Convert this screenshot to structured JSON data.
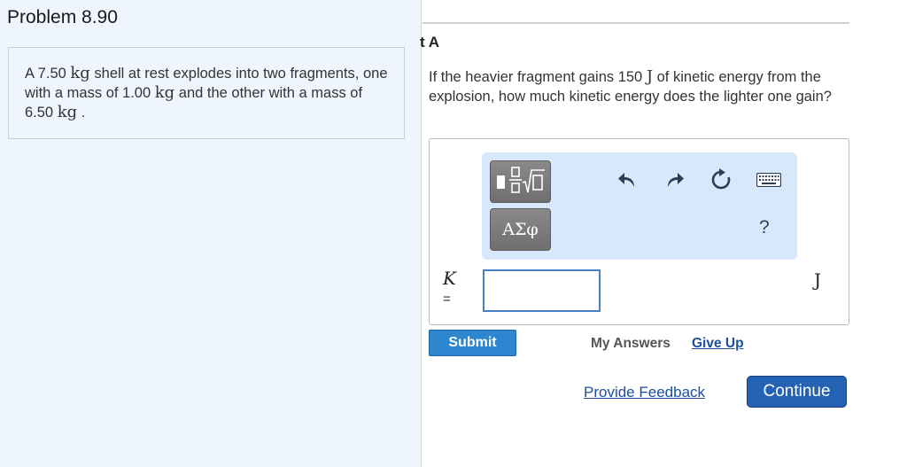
{
  "problem": {
    "title": "Problem 8.90",
    "text": {
      "p1": "A 7.50 ",
      "u1": "kg",
      "p2": " shell at rest explodes into two fragments, one with a mass of 1.00 ",
      "u2": "kg",
      "p3": " and the other with a mass of 6.50 ",
      "u3": "kg",
      "p4": " ."
    }
  },
  "part": {
    "label": "t A",
    "question": {
      "p1": "If the heavier fragment gains 150 ",
      "u1": "J",
      "p2": " of kinetic energy from the explosion, how much kinetic energy does the lighter one gain?"
    }
  },
  "toolbar": {
    "greek_label": "ΑΣφ",
    "help_label": "?",
    "icons": [
      "fraction-sqrt-icon",
      "undo-icon",
      "redo-icon",
      "reset-icon",
      "keyboard-icon"
    ]
  },
  "answer": {
    "variable": "K",
    "equals": "=",
    "value": "",
    "unit": "J"
  },
  "actions": {
    "submit": "Submit",
    "my_answers": "My Answers",
    "give_up": "Give Up",
    "feedback": "Provide Feedback",
    "continue": "Continue"
  },
  "colors": {
    "left_bg": "#eef5fd",
    "toolbar_bg": "#d8e8fb",
    "submit": "#2e86d1",
    "continue": "#2662b3",
    "link": "#1a4fa0"
  }
}
